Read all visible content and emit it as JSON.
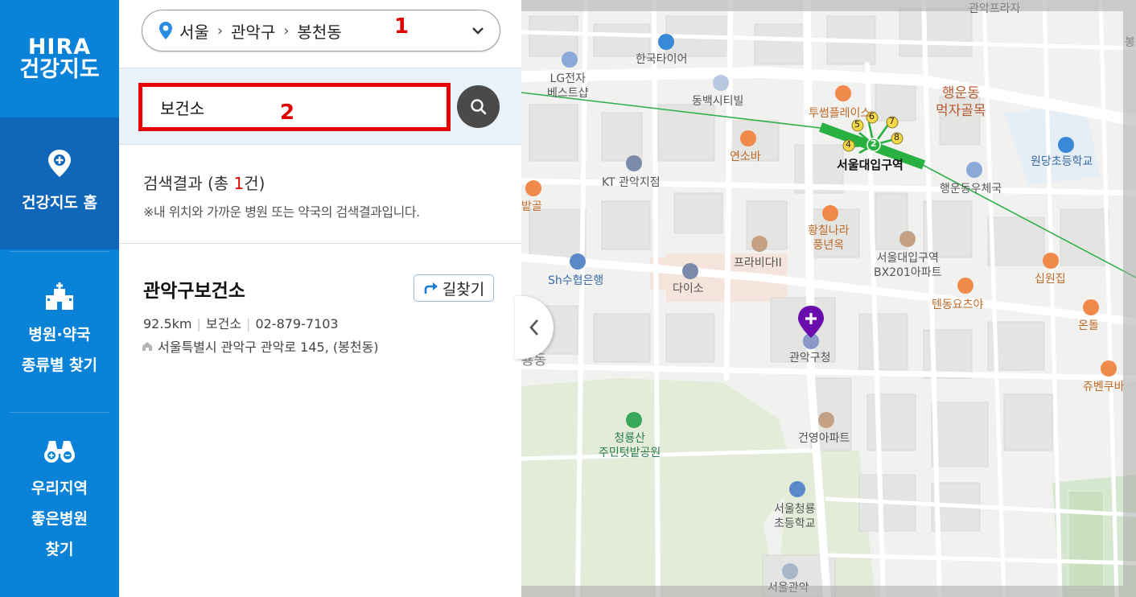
{
  "nav": {
    "logo_line1": "HIRA",
    "logo_line2": "건강지도",
    "home_label": "건강지도 홈",
    "kind_label_1": "병원·약국",
    "kind_label_2": "종류별 찾기",
    "good_label_1": "우리지역",
    "good_label_2": "좋은병원",
    "good_label_3": "찾기"
  },
  "location": {
    "level1": "서울",
    "level2": "관악구",
    "level3": "봉천동"
  },
  "annotations": {
    "mark1": "1",
    "mark2": "2"
  },
  "search": {
    "value": "보건소"
  },
  "results": {
    "summary_prefix": "검색결과 (총 ",
    "summary_count": "1",
    "summary_suffix": "건)",
    "note": "※내 위치와 가까운 병원 또는 약국의 검색결과입니다.",
    "items": [
      {
        "name": "관악구보건소",
        "route_label": "길찾기",
        "distance": "92.5km",
        "type": "보건소",
        "phone": "02-879-7103",
        "address": "서울특별시 관악구 관악로 145, (봉천동)"
      }
    ]
  },
  "map": {
    "labels": {
      "gwanak_plaza": "관악프라자",
      "hankook": "한국타이어",
      "lg_line1": "LG전자",
      "lg_line2": "베스트샵",
      "dongbaek": "동백시티빌",
      "twosome": "투썸플레이스",
      "food_alley_1": "행운동",
      "food_alley_2": "먹자골목",
      "yeonso": "연소바",
      "station": "서울대입구역",
      "wondang": "원당초등학교",
      "kt": "KT 관악지점",
      "post": "행운동우체국",
      "batgol": "밭골",
      "hwangchil_1": "황칠나라",
      "hwangchil_2": "풍년옥",
      "apt_1": "서울대입구역",
      "apt_2": "BX201아파트",
      "prabida": "프라비다II",
      "sipwon": "십원집",
      "sh_bank": "Sh수협은행",
      "daiso": "다이소",
      "tendon": "텐동요츠야",
      "ondol": "온돌",
      "district_edge": "룡동",
      "gwanak_office": "관악구청",
      "jubenkuba": "쥬벤쿠바",
      "park_1": "청룡산",
      "park_2": "주민텃밭공원",
      "geonyeong": "건영아파트",
      "school_1": "서울청룡",
      "school_2": "초등학교",
      "gwanak_bottom": "서울관악",
      "edge_top": "봉",
      "exit_2": "2",
      "exit_4": "4",
      "exit_5": "5",
      "exit_6": "6",
      "exit_7": "7",
      "exit_8": "8"
    },
    "colors": {
      "subway_line": "#2fb04a",
      "marker": "#6a0dad",
      "nav_blue": "#0a82d8",
      "annotation_red": "#e00000"
    }
  }
}
